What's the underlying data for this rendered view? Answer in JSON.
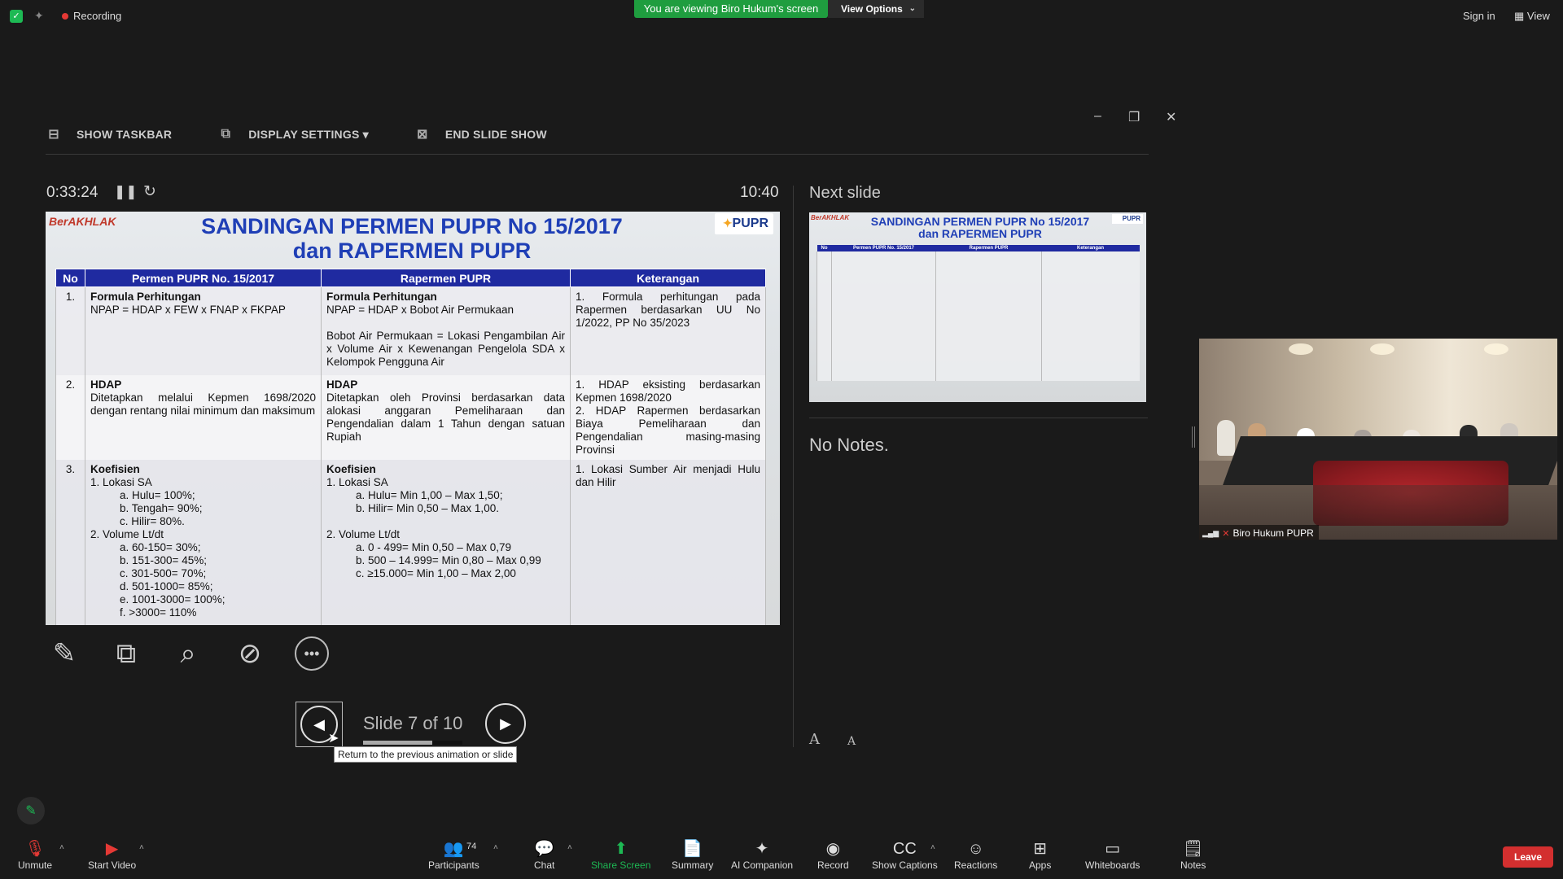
{
  "topbar": {
    "recording": "Recording",
    "viewing_banner": "You are viewing Biro Hukum's screen",
    "view_options": "View Options",
    "sign_in": "Sign in",
    "view": "View"
  },
  "presenter": {
    "toolbar": {
      "show_taskbar": "SHOW TASKBAR",
      "display_settings": "DISPLAY SETTINGS ▾",
      "end_slide_show": "END SLIDE SHOW"
    },
    "elapsed_time": "0:33:24",
    "clock": "10:40",
    "slide_counter": "Slide 7 of 10",
    "progress": 0.7,
    "tooltip": "Return to the previous animation or slide",
    "next_slide_label": "Next slide",
    "no_notes": "No Notes.",
    "font_increase": "A",
    "font_decrease": "A"
  },
  "slide": {
    "logo": "BerAKHLAK",
    "brand": "PUPR",
    "title_line1": "SANDINGAN PERMEN PUPR No 15/2017",
    "title_line2": "dan RAPERMEN PUPR",
    "headers": [
      "No",
      "Permen PUPR No. 15/2017",
      "Rapermen PUPR",
      "Keterangan"
    ],
    "rows": [
      {
        "no": "1.",
        "c1_title": "Formula Perhitungan",
        "c1_text": "NPAP = HDAP x FEW x FNAP x FKPAP",
        "c2_title": "Formula Perhitungan",
        "c2_text": "NPAP = HDAP x Bobot Air Permukaan",
        "c2_text2": "Bobot Air Permukaan = Lokasi Pengambilan Air x Volume Air x Kewenangan Pengelola SDA x Kelompok Pengguna Air",
        "c3": [
          "1.  Formula perhitungan pada Rapermen berdasarkan UU No 1/2022, PP No 35/2023"
        ]
      },
      {
        "no": "2.",
        "c1_title": "HDAP",
        "c1_text": "Ditetapkan melalui Kepmen 1698/2020 dengan rentang nilai minimum dan maksimum",
        "c2_title": "HDAP",
        "c2_text": "Ditetapkan oleh Provinsi berdasarkan data alokasi anggaran Pemeliharaan dan Pengendalian dalam 1 Tahun dengan satuan Rupiah",
        "c3": [
          "1.  HDAP eksisting berdasarkan Kepmen 1698/2020",
          "2.  HDAP Rapermen berdasarkan Biaya Pemeliharaan dan Pengendalian masing-masing Provinsi"
        ]
      },
      {
        "no": "3.",
        "c1_title": "Koefisien",
        "c1_lines": [
          "1.  Lokasi SA",
          "a.  Hulu= 100%;",
          "b.  Tengah= 90%;",
          "c.  Hilir= 80%.",
          "2.  Volume Lt/dt",
          "a.  60-150= 30%;",
          "b.  151-300= 45%;",
          "c.  301-500= 70%;",
          "d.  501-1000= 85%;",
          "e.  1001-3000= 100%;",
          "f.   >3000= 110%"
        ],
        "c2_title": "Koefisien",
        "c2_lines": [
          "1.  Lokasi SA",
          "a.  Hulu= Min 1,00 – Max 1,50;",
          "b.  Hilir= Min 0,50 – Max 1,00.",
          "",
          "2.  Volume Lt/dt",
          "a.  0 - 499= Min 0,50 – Max 0,79",
          "b.  500 – 14.999= Min 0,80 – Max 0,99",
          "c.  ≥15.000= Min 1,00 – Max 2,00"
        ],
        "c3": [
          "1.  Lokasi Sumber Air menjadi Hulu dan Hilir"
        ]
      }
    ]
  },
  "next_slide": {
    "logo": "BerAKHLAK",
    "brand": "PUPR",
    "title_line1": "SANDINGAN PERMEN PUPR No 15/2017",
    "title_line2": "dan RAPERMEN PUPR",
    "headers": [
      "No",
      "Permen PUPR No. 15/2017",
      "Rapermen PUPR",
      "Keterangan"
    ]
  },
  "video": {
    "participant_name": "Biro Hukum PUPR"
  },
  "bottombar": {
    "unmute": "Unmute",
    "start_video": "Start Video",
    "participants": "Participants",
    "participants_count": "74",
    "chat": "Chat",
    "share_screen": "Share Screen",
    "summary": "Summary",
    "ai_companion": "AI Companion",
    "record": "Record",
    "show_captions": "Show Captions",
    "captions_icon": "CC",
    "reactions": "Reactions",
    "apps": "Apps",
    "whiteboards": "Whiteboards",
    "notes": "Notes",
    "leave": "Leave"
  },
  "colors": {
    "viewing_banner": "#1f9d3f",
    "leave": "#d32f2f",
    "slide_header": "#1f2aa0",
    "slide_title": "#1f3fb6"
  }
}
